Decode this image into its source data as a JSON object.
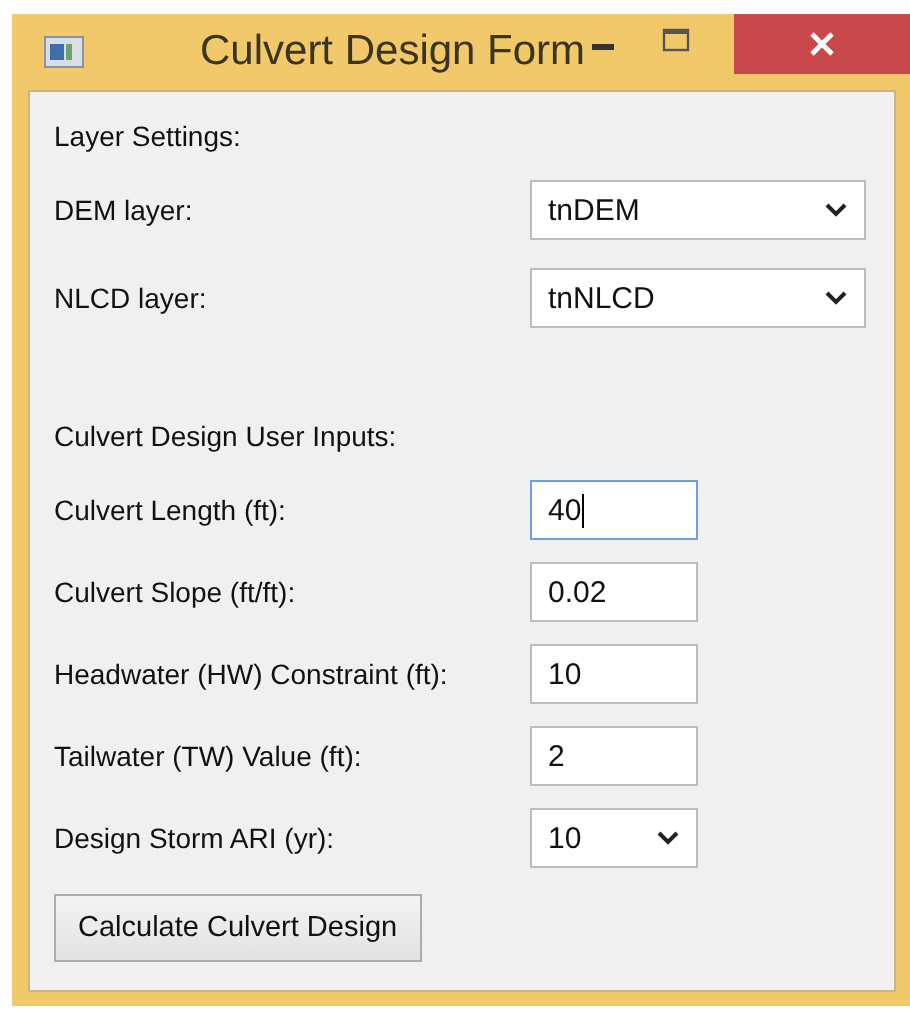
{
  "window": {
    "title": "Culvert Design Form"
  },
  "layer_settings": {
    "heading": "Layer Settings:",
    "rows": [
      {
        "label": "DEM layer:",
        "kind": "combo",
        "value": "tnDEM"
      },
      {
        "label": "NLCD layer:",
        "kind": "combo",
        "value": "tnNLCD"
      }
    ]
  },
  "design_inputs": {
    "heading": "Culvert Design User Inputs:",
    "rows": [
      {
        "label": "Culvert Length (ft):",
        "kind": "text",
        "value": "40",
        "focused": true
      },
      {
        "label": "Culvert Slope (ft/ft):",
        "kind": "text",
        "value": "0.02",
        "focused": false
      },
      {
        "label": "Headwater (HW) Constraint (ft):",
        "kind": "text",
        "value": "10",
        "focused": false
      },
      {
        "label": "Tailwater (TW) Value (ft):",
        "kind": "text",
        "value": "2",
        "focused": false
      },
      {
        "label": "Design Storm ARI (yr):",
        "kind": "combo",
        "value": "10",
        "focused": false
      }
    ]
  },
  "buttons": [
    "Calculate Culvert Design"
  ]
}
